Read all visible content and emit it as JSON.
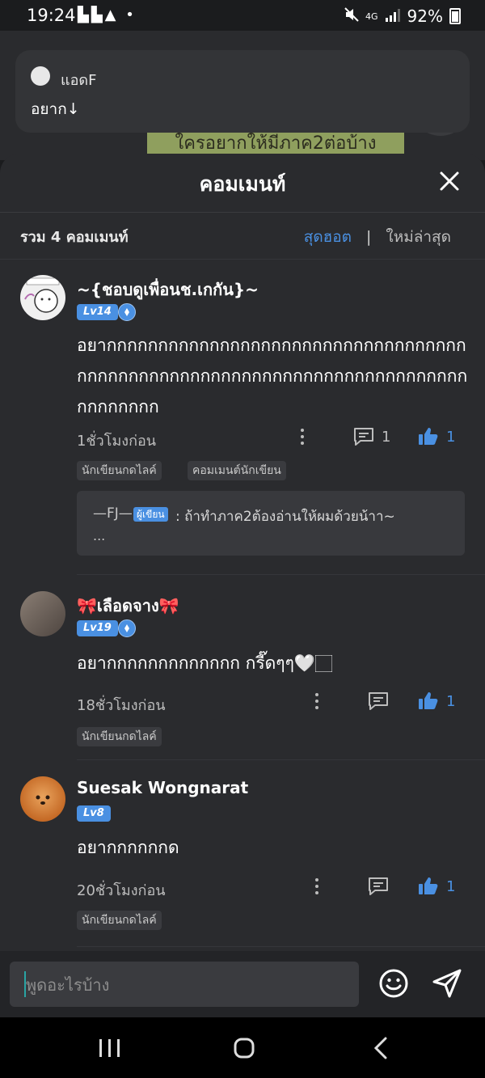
{
  "status_bar": {
    "time": "19:24",
    "left_icons": "▙▙▲ •",
    "network": "4G",
    "battery": "92%"
  },
  "background": {
    "banner_text": "ใครอยากให้มีภาค2ต่อบ้าง"
  },
  "notification": {
    "sender": "แอดF",
    "message": "อยาก↓"
  },
  "sheet": {
    "title": "คอมเมนท์",
    "summary": "รวม 4 คอมเมนท์",
    "sort_hot": "สุดฮอต",
    "sort_separator": "|",
    "sort_new": "ใหม่ล่าสุด"
  },
  "comments": [
    {
      "name": "~{ชอบดูเพื่อนช.เกกัน}~",
      "level": "Lv14",
      "text": "อยากกกกกกกกกกกกกกกกกกกกกกกกกกกกกกกกกกกกกกกกกกกกกกกกกกกกกกกกกกกกกกกกกกกกกกกกกกกกกกกกก",
      "time": "1ชั่วโมงก่อน",
      "reply_count": "1",
      "likes": "1",
      "tags": [
        "นักเขียนกดไลค์",
        "คอมเมนต์นักเขียน"
      ],
      "reply": {
        "author": "—FJ—",
        "badge": "ผู้เขียน",
        "text": ": ถ้าทำภาค2ต้องอ่านให้ผมด้วยน้าา~",
        "ellipsis": "..."
      }
    },
    {
      "name": "🎀เลือดจาง🎀",
      "level": "Lv19",
      "text": "อยากกกกกกกกกกกกก กรี๊ดๆๆ🤍🏻",
      "time": "18ชั่วโมงก่อน",
      "likes": "1",
      "tags": [
        "นักเขียนกดไลค์"
      ]
    },
    {
      "name": "Suesak Wongnarat",
      "level": "Lv8",
      "text": "อยากกกกกกด",
      "time": "20ชั่วโมงก่อน",
      "likes": "1",
      "tags": [
        "นักเขียนกดไลค์"
      ]
    }
  ],
  "input": {
    "placeholder": "พูดอะไรบ้าง"
  },
  "icons": {
    "close": "close-icon",
    "more": "more-vertical-icon",
    "reply": "comment-icon",
    "like": "thumbs-up-icon",
    "emoji": "smiley-icon",
    "send": "send-icon"
  },
  "colors": {
    "accent": "#4a90e2",
    "sheet_bg": "#2a2b2e",
    "text": "#ffffff",
    "muted": "#bdbdbd"
  }
}
